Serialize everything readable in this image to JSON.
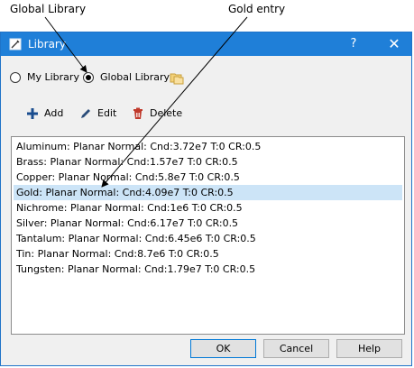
{
  "callouts": {
    "global_library": "Global Library",
    "gold_entry": "Gold entry"
  },
  "window": {
    "title": "Library",
    "help_button": "?",
    "close_button": "✕"
  },
  "radio": {
    "my_library": "My Library",
    "global_library": "Global Library",
    "selected": "Global Library"
  },
  "toolbar": {
    "add_label": "Add",
    "edit_label": "Edit",
    "delete_label": "Delete"
  },
  "list": {
    "items": [
      "Aluminum:  Planar Normal: Cnd:3.72e7 T:0 CR:0.5",
      "Brass:  Planar Normal: Cnd:1.57e7 T:0 CR:0.5",
      "Copper:  Planar Normal: Cnd:5.8e7 T:0 CR:0.5",
      "Gold:  Planar Normal: Cnd:4.09e7 T:0 CR:0.5",
      "Nichrome:  Planar Normal: Cnd:1e6 T:0 CR:0.5",
      "Silver:  Planar Normal: Cnd:6.17e7 T:0 CR:0.5",
      "Tantalum:  Planar Normal: Cnd:6.45e6 T:0 CR:0.5",
      "Tin:  Planar Normal: Cnd:8.7e6 T:0 CR:0.5",
      "Tungsten:  Planar Normal: Cnd:1.79e7 T:0 CR:0.5"
    ],
    "selected_index": 3
  },
  "buttons": {
    "ok": "OK",
    "cancel": "Cancel",
    "help": "Help"
  },
  "colors": {
    "titlebar": "#1f7fd8",
    "selection": "#cce4f7",
    "add_icon": "#1a4d8f",
    "delete_icon": "#c0392b"
  },
  "icons": {
    "title": "library-window-icon",
    "folder": "folder-copy-icon",
    "add": "plus-icon",
    "edit": "pencil-icon",
    "delete": "trash-icon"
  }
}
